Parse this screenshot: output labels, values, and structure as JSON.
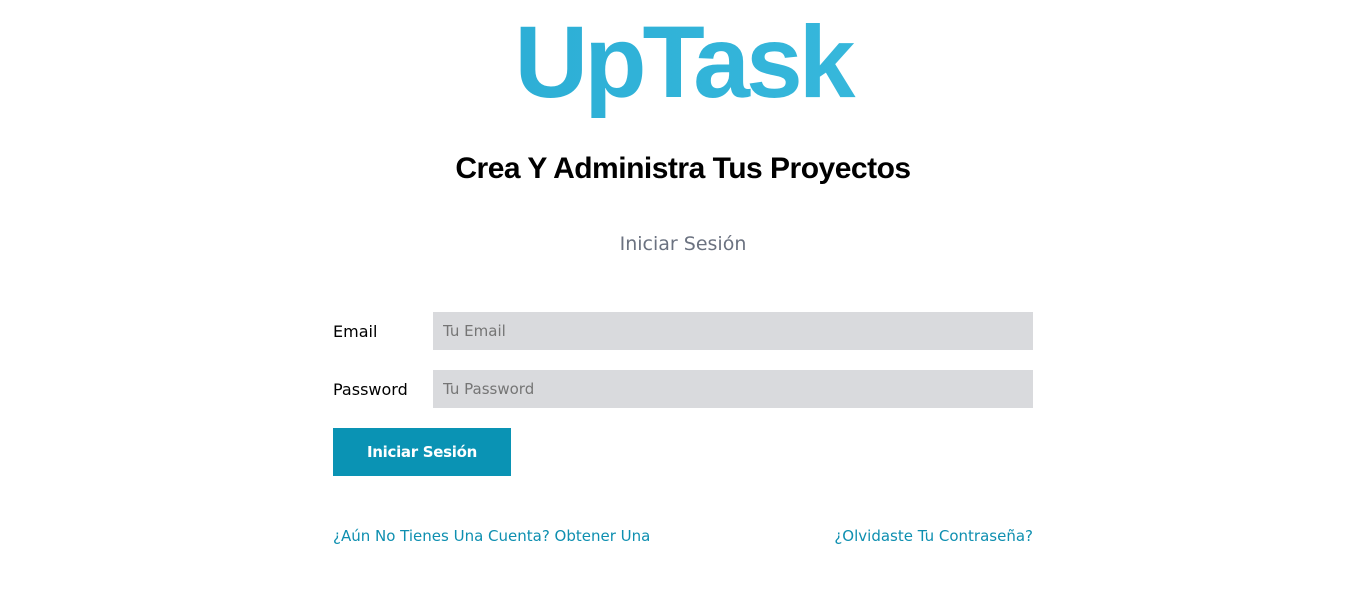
{
  "brand": {
    "logo_text": "UpTask",
    "tagline": "Crea Y Administra Tus Proyectos"
  },
  "login": {
    "title": "Iniciar Sesión",
    "email": {
      "label": "Email",
      "placeholder": "Tu Email",
      "value": ""
    },
    "password": {
      "label": "Password",
      "placeholder": "Tu Password",
      "value": ""
    },
    "submit_label": "Iniciar Sesión"
  },
  "links": {
    "create_account": "¿Aún No Tienes Una Cuenta? Obtener Una",
    "forgot_password": "¿Olvidaste Tu Contraseña?"
  },
  "colors": {
    "brand_gradient_start": "#1fa2cd",
    "brand_gradient_end": "#44c4e4",
    "button_bg": "#0a93b4",
    "link": "#0e8fb0",
    "input_bg": "#d9dadd",
    "muted_text": "#6b7280"
  }
}
